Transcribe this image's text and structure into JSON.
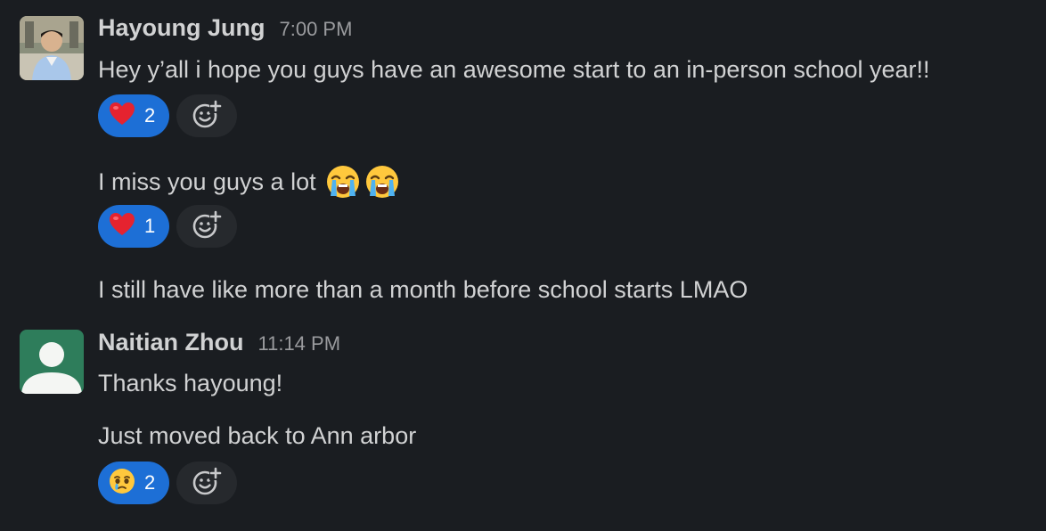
{
  "messages": [
    {
      "author": "Hayoung Jung",
      "time": "7:00 PM",
      "avatar_icon": "profile-photo",
      "lines": [
        {
          "text": "Hey y’all i hope you guys have an awesome start to an in-person school year!!",
          "reactions": [
            {
              "emoji": "heart-emoji",
              "count": "2"
            }
          ]
        },
        {
          "text": "I miss you guys a lot",
          "inline_emojis": [
            "loudly-crying-face-emoji",
            "loudly-crying-face-emoji"
          ],
          "reactions": [
            {
              "emoji": "heart-emoji",
              "count": "1"
            }
          ]
        },
        {
          "text": "I still have like more than a month before school starts LMAO"
        }
      ]
    },
    {
      "author": "Naitian Zhou",
      "time": "11:14 PM",
      "avatar_icon": "default-user-avatar",
      "avatar_color": "#2e7d5b",
      "lines": [
        {
          "text": "Thanks hayoung!"
        },
        {
          "text": "Just moved back to Ann arbor",
          "reactions": [
            {
              "emoji": "face-holding-back-tears-emoji",
              "count": "2"
            }
          ]
        }
      ]
    }
  ],
  "colors": {
    "background": "#1a1d21",
    "text": "#d1d2d3",
    "timestamp": "#9a9b9e",
    "reaction_active": "#1d6fd6",
    "reaction_add": "#26292d"
  },
  "add_reaction_icon": "add-emoji-icon"
}
